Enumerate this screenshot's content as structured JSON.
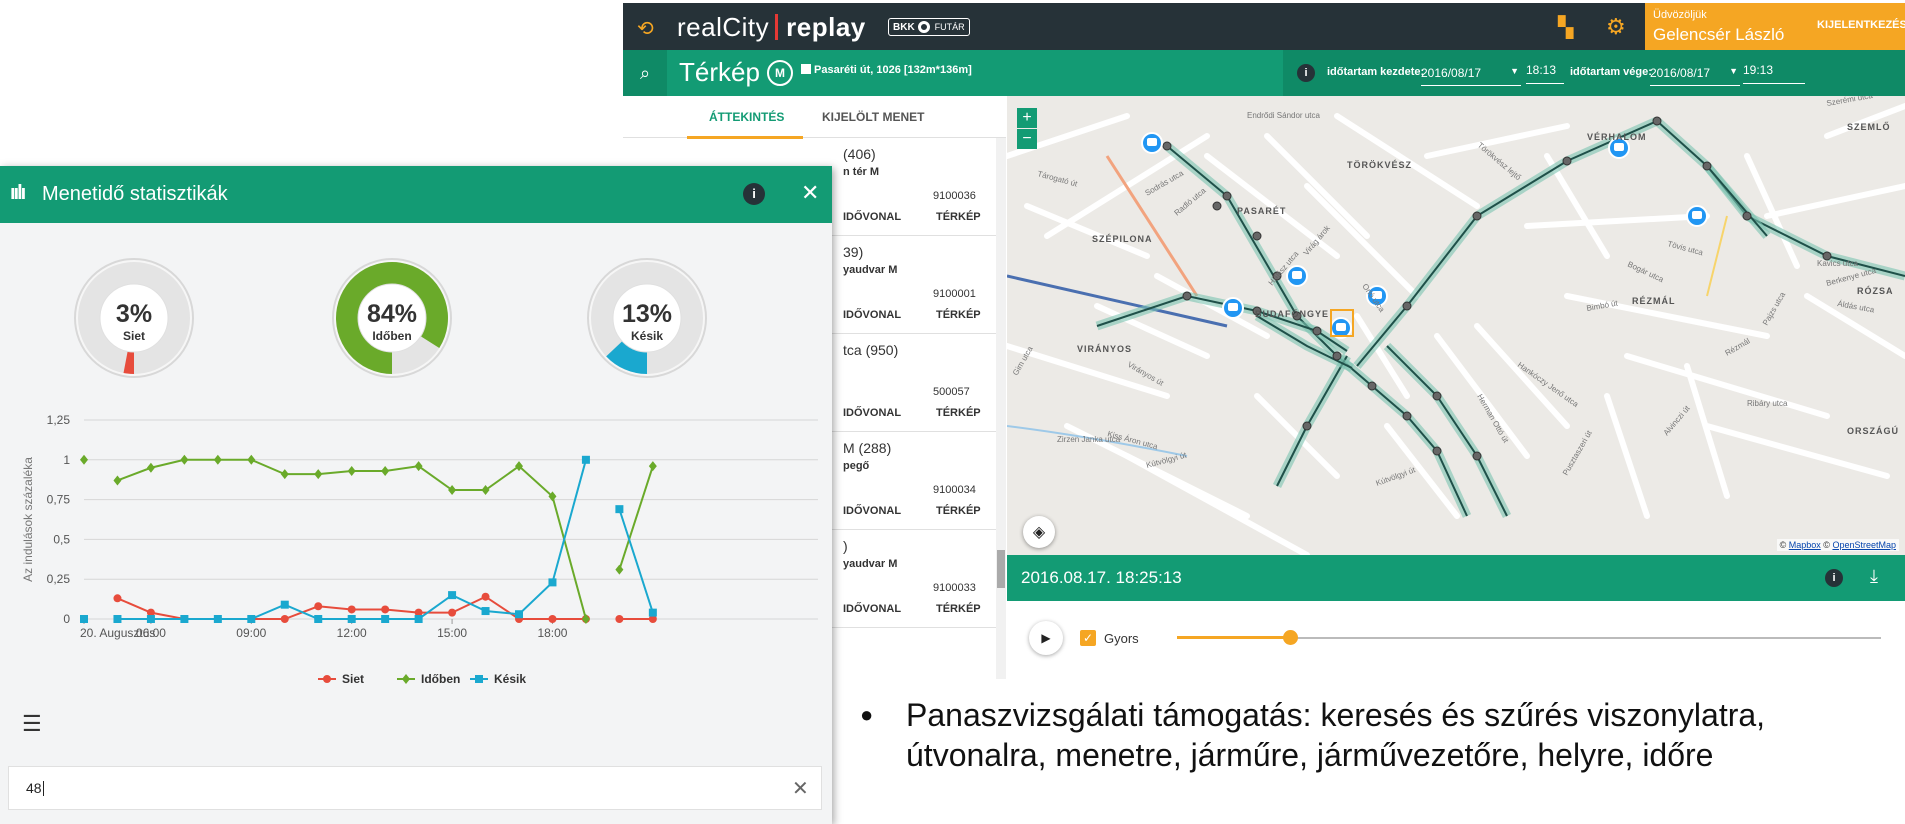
{
  "app": {
    "brand_light": "realCity",
    "brand_bold": "replay",
    "bkk_label": "BKK",
    "futar_label": "FUTÁR",
    "welcome": "Üdvözöljük",
    "user_name": "Gelencsér László",
    "logout_label": "KIJELENTKEZÉS",
    "page_title": "Térkép",
    "map_badge": "M",
    "location": "Pasaréti út, 1026 [132m*136m]",
    "time_filter": {
      "start_label": "időtartam kezdete:",
      "start_date": "2016/08/17",
      "start_time": "18:13",
      "end_label": "időtartam vége:",
      "end_date": "2016/08/17",
      "end_time": "19:13"
    },
    "tabs": {
      "overview": "ÁTTEKINTÉS",
      "selected_trip": "KIJELÖLT MENET"
    },
    "trips": [
      {
        "route": "(406)",
        "stop": "n tér M",
        "id": "9100036",
        "link1": "IDŐVONAL",
        "link2": "TÉRKÉP"
      },
      {
        "route": "39)",
        "stop": "yaudvar M",
        "id": "9100001",
        "link1": "IDŐVONAL",
        "link2": "TÉRKÉP"
      },
      {
        "route": "tca (950)",
        "stop": "",
        "id": "500057",
        "link1": "IDŐVONAL",
        "link2": "TÉRKÉP"
      },
      {
        "route": "M (288)",
        "stop": "pegő",
        "id": "9100034",
        "link1": "IDŐVONAL",
        "link2": "TÉRKÉP"
      },
      {
        "route": ")",
        "stop": "yaudvar M",
        "id": "9100033",
        "link1": "IDŐVONAL",
        "link2": "TÉRKÉP"
      }
    ],
    "map": {
      "zoom_in": "+",
      "zoom_out": "−",
      "attribution_prefix": "©",
      "mapbox": "Mapbox",
      "osm": "OpenStreetMap",
      "districts": [
        "TÖRÖKVÉSZ",
        "PASARÉT",
        "SZÉPILONA",
        "BUDAFÖNGYE",
        "VIRÁNYOS",
        "RÉZMÁL",
        "VÉRHALOM",
        "SZEMLŐ",
        "RÓZSA",
        "ORSZÁGÚ"
      ],
      "streets": [
        "Endrődi Sándor utca",
        "Tárogató út",
        "Sodrás utca",
        "Radló utca",
        "Hidász utca",
        "Virág árok",
        "Orló utca",
        "Gim utca",
        "Virányos út",
        "Kiss Áron utca",
        "Zirzen Janka utca",
        "Kútvölgyi út",
        "Herman Ottó út",
        "Hankóczy Jenő utca",
        "Bimbó út",
        "Tövis utca",
        "Bogár utca",
        "Rézmál",
        "Ribáry utca",
        "Törökvész lejtő",
        "Pusztaszeri út",
        "Alvinczi út",
        "Szerémi utca",
        "Berkenye utca",
        "Áldás utca",
        "Pajzs utca",
        "Kavics utca",
        "Kútvölgyi út"
      ]
    },
    "playback": {
      "datetime": "2016.08.17. 18:25:13",
      "fast_label": "Gyors",
      "fast_checked": true,
      "progress": 0.16
    }
  },
  "stats": {
    "title": "Menetidő statisztikák",
    "gauges": [
      {
        "value_label": "3%",
        "name": "Siet",
        "fraction": 0.03,
        "color": "#e74c3c"
      },
      {
        "value_label": "84%",
        "name": "Időben",
        "fraction": 0.84,
        "color": "#6aaa2a"
      },
      {
        "value_label": "13%",
        "name": "Késik",
        "fraction": 0.13,
        "color": "#1aa8cf"
      }
    ],
    "search_value": "48",
    "chart_data": {
      "type": "line",
      "ylabel": "Az indulások százaléka",
      "ylim": [
        0,
        1.25
      ],
      "y_ticks": [
        "0",
        "0,25",
        "0,5",
        "0,75",
        "1",
        "1,25"
      ],
      "x_range_hours": [
        4,
        21
      ],
      "x_ticks": [
        {
          "label": "20. Augusztus",
          "hour": 4
        },
        {
          "label": "06:00",
          "hour": 6
        },
        {
          "label": "09:00",
          "hour": 9
        },
        {
          "label": "12:00",
          "hour": 12
        },
        {
          "label": "15:00",
          "hour": 15
        },
        {
          "label": "18:00",
          "hour": 18
        }
      ],
      "legend": [
        "Siet",
        "Időben",
        "Késik"
      ],
      "legend_position": "bottom-center",
      "grid": true,
      "series": [
        {
          "name": "Siet",
          "color": "#e74c3c",
          "marker": "circle",
          "segments": [
            [
              [
                5,
                0.13
              ],
              [
                6,
                0.04
              ],
              [
                7,
                0
              ],
              [
                8,
                0
              ],
              [
                9,
                0
              ],
              [
                10,
                0
              ],
              [
                11,
                0.08
              ],
              [
                12,
                0.06
              ],
              [
                13,
                0.06
              ],
              [
                14,
                0.04
              ],
              [
                15,
                0.04
              ],
              [
                16,
                0.14
              ],
              [
                17,
                0
              ],
              [
                18,
                0
              ],
              [
                19,
                0
              ]
            ],
            [
              [
                20,
                0
              ],
              [
                21,
                0
              ]
            ]
          ]
        },
        {
          "name": "Időben",
          "color": "#6aaa2a",
          "marker": "diamond",
          "segments": [
            [
              [
                4,
                1
              ]
            ],
            [
              [
                5,
                0.87
              ],
              [
                6,
                0.95
              ],
              [
                7,
                1
              ],
              [
                8,
                1
              ],
              [
                9,
                1
              ],
              [
                10,
                0.91
              ],
              [
                11,
                0.91
              ],
              [
                12,
                0.93
              ],
              [
                13,
                0.93
              ],
              [
                14,
                0.96
              ],
              [
                15,
                0.81
              ],
              [
                16,
                0.81
              ],
              [
                17,
                0.96
              ],
              [
                18,
                0.77
              ],
              [
                19,
                0
              ]
            ],
            [
              [
                20,
                0.31
              ],
              [
                21,
                0.96
              ]
            ]
          ]
        },
        {
          "name": "Késik",
          "color": "#1aa8cf",
          "marker": "square",
          "segments": [
            [
              [
                4,
                0
              ]
            ],
            [
              [
                5,
                0
              ],
              [
                6,
                0
              ],
              [
                7,
                0
              ],
              [
                8,
                0
              ],
              [
                9,
                0
              ],
              [
                10,
                0.09
              ],
              [
                11,
                0
              ],
              [
                12,
                0
              ],
              [
                13,
                0
              ],
              [
                14,
                0
              ],
              [
                15,
                0.15
              ],
              [
                16,
                0.05
              ],
              [
                17,
                0.03
              ],
              [
                18,
                0.23
              ],
              [
                19,
                1
              ]
            ],
            [
              [
                20,
                0.69
              ],
              [
                21,
                0.04
              ]
            ]
          ]
        }
      ]
    }
  },
  "slide": {
    "bullet": "Panaszvizsgálati támogatás: keresés és szűrés viszonylatra, útvonalra, menetre, járműre, járművezetőre, helyre, időre"
  }
}
